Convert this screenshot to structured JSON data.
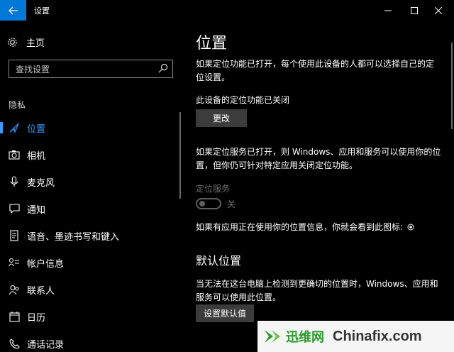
{
  "window": {
    "title": "设置"
  },
  "sidebar": {
    "home_label": "主页",
    "search_placeholder": "查找设置",
    "group_label": "隐私",
    "items": [
      {
        "label": "位置",
        "icon": "location-icon",
        "active": true
      },
      {
        "label": "相机",
        "icon": "camera-icon",
        "active": false
      },
      {
        "label": "麦克风",
        "icon": "microphone-icon",
        "active": false
      },
      {
        "label": "通知",
        "icon": "notification-icon",
        "active": false
      },
      {
        "label": "语音、墨迹书写和键入",
        "icon": "speech-inking-icon",
        "active": false
      },
      {
        "label": "帐户信息",
        "icon": "account-info-icon",
        "active": false
      },
      {
        "label": "联系人",
        "icon": "contacts-icon",
        "active": false
      },
      {
        "label": "日历",
        "icon": "calendar-icon",
        "active": false
      },
      {
        "label": "通话记录",
        "icon": "call-history-icon",
        "active": false
      }
    ]
  },
  "main": {
    "title": "位置",
    "intro_line1": "如果定位功能已打开，每个使用此设备的人都可以选择自己的定",
    "intro_line2": "位设置。",
    "device_status": "此设备的定位功能已关闭",
    "change_button": "更改",
    "service_line1": "如果定位服务已打开，则 Windows、应用和服务可以使用你的位",
    "service_line2": "置，但你仍可针对特定应用关闭定位功能。",
    "location_service_label": "定位服务",
    "toggle_state": "关",
    "icon_note": "如果有应用正在使用你的位置信息，你就会看到此图标:",
    "default_title": "默认位置",
    "default_line1": "当无法在这台电脑上检测到更确切的位置时，Windows、应用和",
    "default_line2": "服务可以使用此位置。",
    "set_default_button": "设置默认值"
  },
  "watermark": {
    "cn": "迅维网",
    "en": "Chinafix.com"
  },
  "colors": {
    "accent": "#0078d7",
    "active_text": "#3b9cff",
    "button_bg": "#3c3c3c",
    "disabled": "#6f6f6f",
    "watermark_green": "#2a9a2a"
  }
}
